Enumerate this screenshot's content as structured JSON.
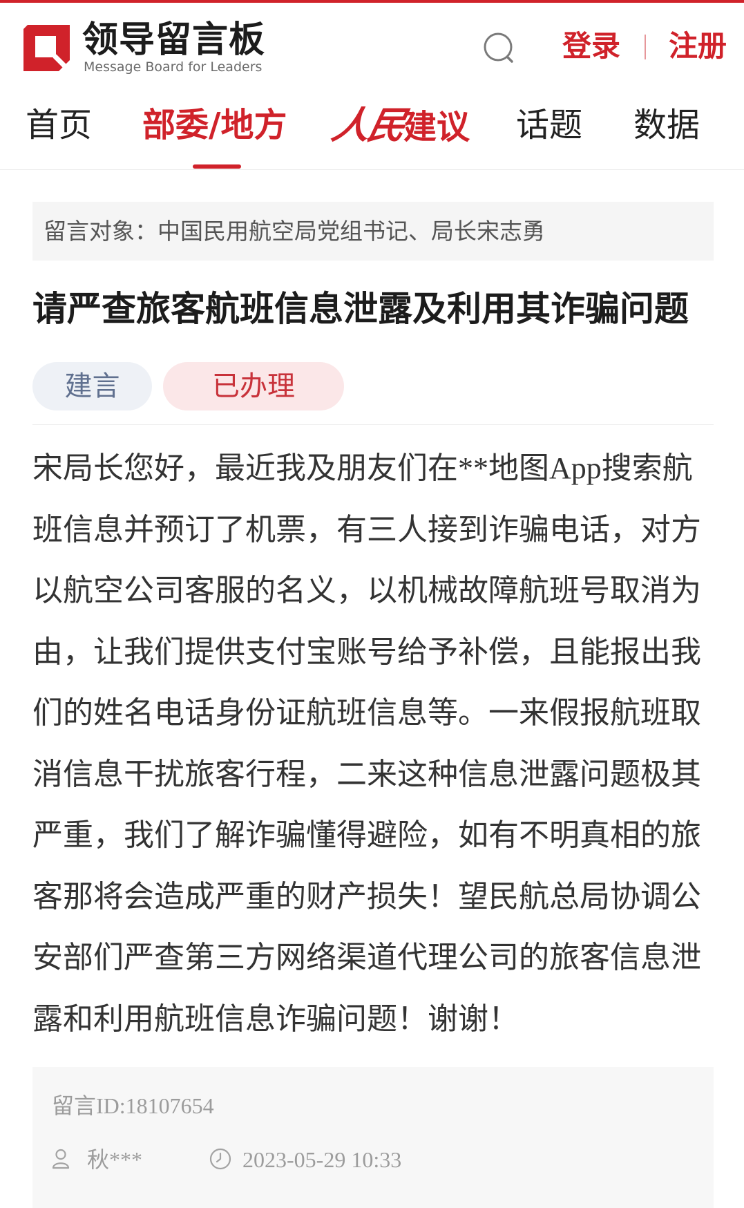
{
  "colors": {
    "brand_red": "#d0222a",
    "nav_text": "#222222",
    "text_dark": "#1c1c1c",
    "text_body": "#333333",
    "text_muted": "#9c9c9c",
    "panel_bg": "#f5f5f5",
    "meta_bg": "#f7f7f7",
    "divider": "#ececec",
    "tag_type_bg": "#eef1f6",
    "tag_type_text": "#60708f",
    "tag_status_bg": "#fbe7e8",
    "tag_status_text": "#c8323a"
  },
  "header": {
    "logo_icon": "message-board-logo-icon",
    "logo_title": "领导留言板",
    "logo_subtitle": "Message Board for Leaders",
    "search_icon": "search-icon",
    "login_label": "登录",
    "register_label": "注册"
  },
  "nav": {
    "items": [
      {
        "label": "首页",
        "active": false
      },
      {
        "label": "部委/地方",
        "active": true
      },
      {
        "label_parts": [
          "人民",
          "建议"
        ],
        "active": false
      },
      {
        "label": "话题",
        "active": false
      },
      {
        "label": "数据",
        "active": false
      }
    ]
  },
  "message": {
    "recipient_label": "留言对象：",
    "recipient": "中国民用航空局党组书记、局长宋志勇",
    "title": "请严查旅客航班信息泄露及利用其诈骗问题",
    "tags": [
      "建言",
      "已办理"
    ],
    "body_lines": [
      "宋局长您好，最近我及朋友们在**地图App搜索航",
      "班信息并预订了机票，有三人接到诈骗电话，对方",
      "以航空公司客服的名义，以机械故障航班号取消为",
      "由，让我们提供支付宝账号给予补偿，且能报出我",
      "们的姓名电话身份证航班信息等。一来假报航班取",
      "消信息干扰旅客行程，二来这种信息泄露问题极其",
      "严重，我们了解诈骗懂得避险，如有不明真相的旅",
      "客那将会造成严重的财产损失！望民航总局协调公",
      "安部们严查第三方网络渠道代理公司的旅客信息泄",
      "露和利用航班信息诈骗问题！谢谢！"
    ],
    "id_label": "留言ID:",
    "id": "18107654",
    "author_icon": "user-icon",
    "author": "秋***",
    "time_icon": "clock-icon",
    "datetime": "2023-05-29 10:33"
  }
}
